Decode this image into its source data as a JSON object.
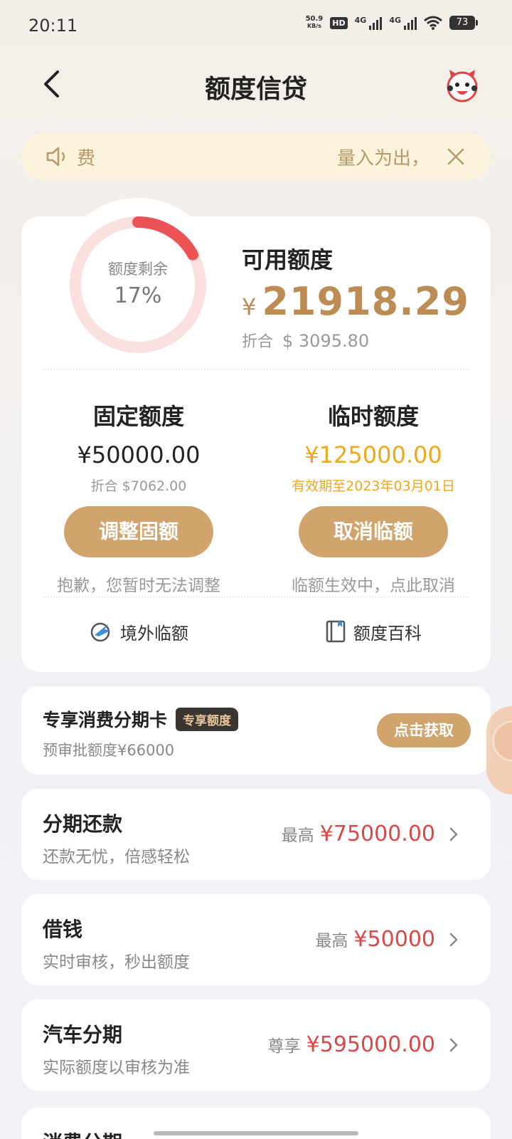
{
  "status_bar": {
    "time": "20:11",
    "net_speed_value": "50.9",
    "net_speed_unit": "KB/s",
    "hd": "HD",
    "sim1": "4G",
    "sim2": "4G",
    "battery": "73"
  },
  "header": {
    "title": "额度信贷"
  },
  "notice": {
    "text_left": "费",
    "text_right": "量入为出，"
  },
  "credit": {
    "ring_label": "额度剩余",
    "ring_value": "17%",
    "ring_fraction": 0.17,
    "available_title": "可用额度",
    "currency_symbol": "¥",
    "available_amount": "21918.29",
    "converted_label": "折合",
    "converted_amount": "$ 3095.80"
  },
  "fixed_quota": {
    "title": "固定额度",
    "amount": "¥50000.00",
    "converted": "折合 $7062.00",
    "button": "调整固额",
    "hint": "抱歉，您暂时无法调整"
  },
  "temp_quota": {
    "title": "临时额度",
    "amount": "¥125000.00",
    "validity": "有效期至2023年03月01日",
    "button": "取消临额",
    "hint": "临额生效中，点此取消"
  },
  "links": {
    "overseas": "境外临额",
    "wiki": "额度百科"
  },
  "special_card": {
    "title": "专享消费分期卡",
    "tag": "专享额度",
    "subtitle": "预审批额度¥66000",
    "button": "点击获取"
  },
  "products": [
    {
      "title": "分期还款",
      "subtitle": "还款无忧，倍感轻松",
      "prefix": "最高",
      "amount": "¥75000.00"
    },
    {
      "title": "借钱",
      "subtitle": "实时审核，秒出额度",
      "prefix": "最高",
      "amount": "¥50000"
    },
    {
      "title": "汽车分期",
      "subtitle": "实际额度以审核为准",
      "prefix": "尊享",
      "amount": "¥595000.00"
    },
    {
      "title": "消费分期"
    }
  ],
  "colors": {
    "gold_button": "#d2a46d",
    "amount_gold": "#bd8c54",
    "temp_gold": "#efa81c",
    "amount_red": "#d94848",
    "ring_track": "#fbe0e0",
    "ring_fill": "#ec5356"
  }
}
